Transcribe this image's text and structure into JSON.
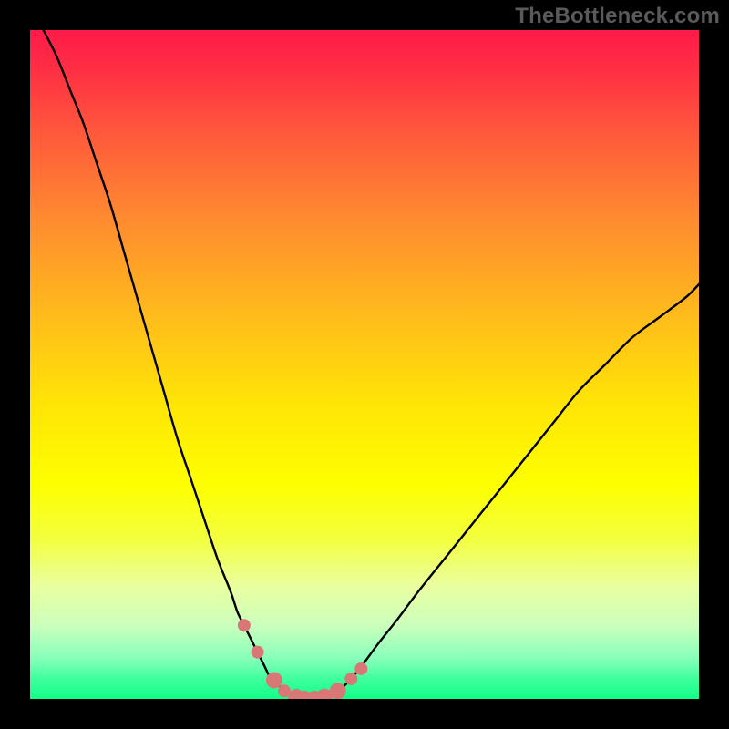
{
  "attribution": "TheBottleneck.com",
  "chart_data": {
    "type": "line",
    "title": "",
    "xlabel": "",
    "ylabel": "",
    "xlim": [
      0,
      100
    ],
    "ylim": [
      0,
      100
    ],
    "series": [
      {
        "name": "bottleneck-curve",
        "x": [
          2,
          4,
          6,
          8,
          10,
          12,
          14,
          16,
          18,
          20,
          22,
          24,
          26,
          28,
          30,
          31,
          32,
          33,
          34,
          35,
          36,
          37,
          38,
          39,
          40,
          41,
          42,
          43,
          44,
          46,
          48,
          50,
          52,
          55,
          58,
          62,
          66,
          70,
          74,
          78,
          82,
          86,
          90,
          94,
          98,
          100
        ],
        "y": [
          100,
          96,
          91,
          86,
          80,
          74,
          67,
          60,
          53,
          46,
          39,
          33,
          27,
          21,
          16,
          13,
          11,
          9,
          7,
          5,
          3,
          2.2,
          1.2,
          0.6,
          0.2,
          0,
          0,
          0,
          0.3,
          1.2,
          3,
          5.5,
          8.2,
          12,
          16,
          21,
          26,
          31,
          36,
          41,
          46,
          50,
          54,
          57,
          60,
          62
        ]
      }
    ],
    "markers": {
      "name": "optimal-range-dots",
      "x": [
        32,
        34,
        36.5,
        38,
        39.8,
        41,
        42.5,
        44,
        46,
        48,
        49.5
      ],
      "y": [
        11,
        7,
        2.8,
        1.2,
        0.25,
        0,
        0,
        0.3,
        1.2,
        3,
        4.5
      ],
      "color": "#d97777",
      "radius_px": [
        7,
        7,
        9,
        7,
        9,
        9,
        9,
        9,
        9,
        7,
        7
      ]
    },
    "gradient": {
      "stops": [
        {
          "pos": 0.0,
          "color": "#ff1a49"
        },
        {
          "pos": 0.28,
          "color": "#ff8a30"
        },
        {
          "pos": 0.56,
          "color": "#ffe506"
        },
        {
          "pos": 0.83,
          "color": "#eaff9f"
        },
        {
          "pos": 1.0,
          "color": "#11ff88"
        }
      ]
    }
  }
}
